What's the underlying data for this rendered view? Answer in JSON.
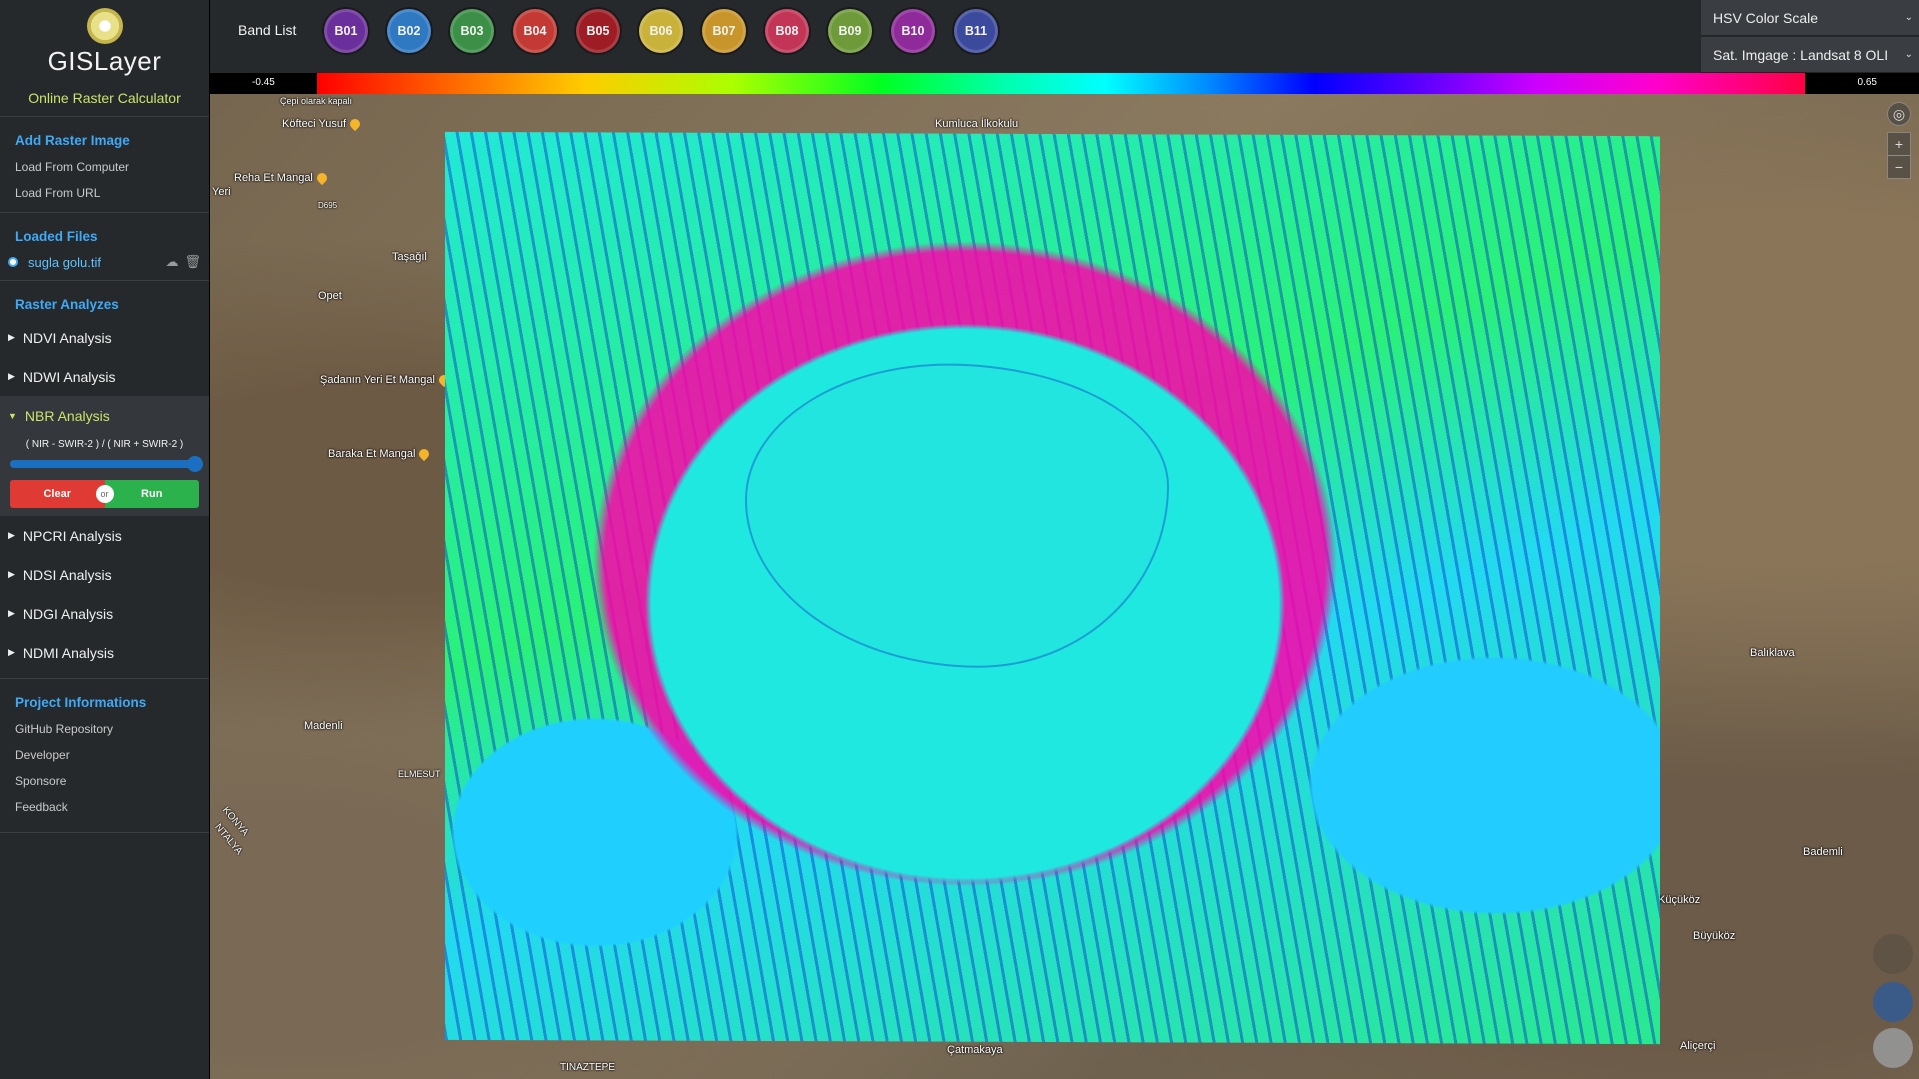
{
  "app": {
    "title": "GISLayer",
    "subtitle": "Online Raster Calculator"
  },
  "sidebar": {
    "add_raster": {
      "title": "Add Raster Image",
      "links": [
        "Load From Computer",
        "Load From URL"
      ]
    },
    "loaded_files": {
      "title": "Loaded Files",
      "file_name": "sugla golu.tif"
    },
    "raster_analyzes": {
      "title": "Raster Analyzes",
      "items": [
        {
          "label": "NDVI Analysis"
        },
        {
          "label": "NDWI Analysis"
        },
        {
          "label": "NBR Analysis",
          "formula": "( NIR - SWIR-2 ) / ( NIR + SWIR-2 )",
          "clear": "Clear",
          "or": "or",
          "run": "Run"
        },
        {
          "label": "NPCRI Analysis"
        },
        {
          "label": "NDSI Analysis"
        },
        {
          "label": "NDGI Analysis"
        },
        {
          "label": "NDMI Analysis"
        }
      ]
    },
    "project": {
      "title": "Project Informations",
      "links": [
        "GitHub Repository",
        "Developer",
        "Sponsore",
        "Feedback"
      ]
    }
  },
  "topbar": {
    "band_list_label": "Band List",
    "bands": [
      {
        "label": "B01",
        "color": "#6a2f9a"
      },
      {
        "label": "B02",
        "color": "#2f78c2"
      },
      {
        "label": "B03",
        "color": "#3c8f47"
      },
      {
        "label": "B04",
        "color": "#c23a33"
      },
      {
        "label": "B05",
        "color": "#9e1c24"
      },
      {
        "label": "B06",
        "color": "#c8b23a"
      },
      {
        "label": "B07",
        "color": "#c8952a"
      },
      {
        "label": "B08",
        "color": "#c23556"
      },
      {
        "label": "B09",
        "color": "#6f9a3a"
      },
      {
        "label": "B10",
        "color": "#8f2a9a"
      },
      {
        "label": "B11",
        "color": "#3c4a9e"
      }
    ],
    "color_scale_select": "HSV Color Scale",
    "satellite_select": "Sat. Imgage : Landsat 8 OLI"
  },
  "scale": {
    "min": "-0.45",
    "max": "0.65"
  },
  "map_labels": {
    "kumluca": "Kumluca İlkokulu",
    "kofteci": "Köfteci Yusuf",
    "reha": "Reha Et Mangal",
    "tasagil": "Taşağıl",
    "opet": "Opet",
    "sadanin": "Şadanın Yeri Et Mangal",
    "baraka": "Baraka Et Mangal",
    "madenli": "Madenli",
    "elmesut": "ELMESUT",
    "konya": "KONYA",
    "antalya": "NTALYA",
    "balikiava": "Balıklava",
    "bademli": "Bademli",
    "kucukoz": "Küçüköz",
    "buyukoz": "Büyüköz",
    "catmakaya": "Çatmakaya",
    "alicerci": "Aliçerçi",
    "tinaztepe": "TINAZTEPE",
    "d695": "D695",
    "yeri": "Yeri",
    "cepkapal": "Çepi olarak kapalı"
  }
}
